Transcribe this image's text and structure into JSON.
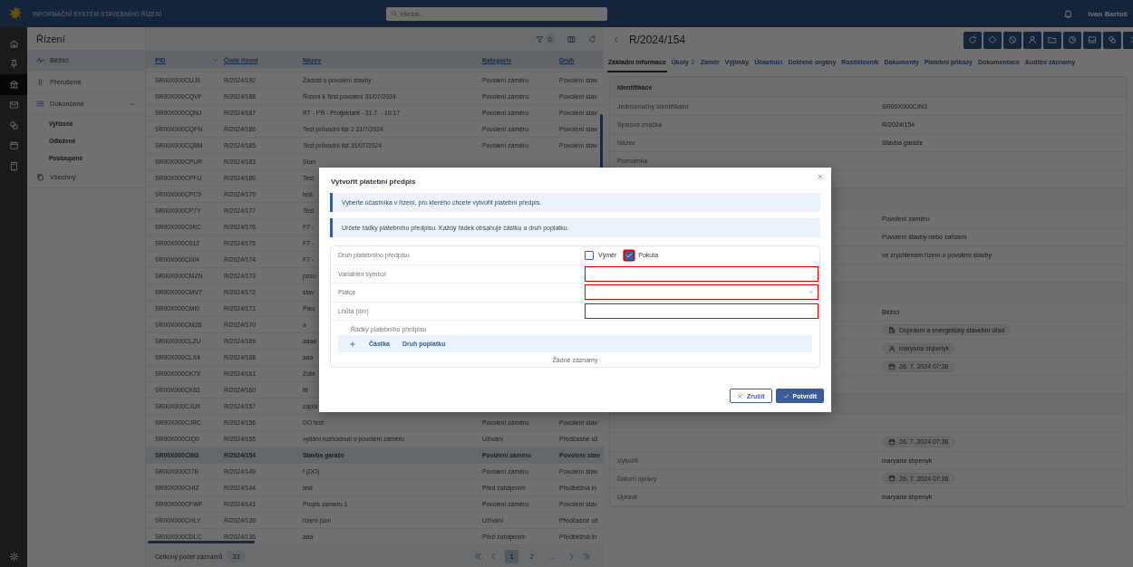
{
  "topbar": {
    "title": "INFORMAČNÍ SYSTÉM STAVEBNÍHO ŘÍZENÍ",
    "search": {
      "placeholder": "Hledat..."
    },
    "user": "Ivan Bartoš"
  },
  "rail": [
    {
      "selected": false
    },
    {
      "selected": false
    },
    {
      "selected": true
    },
    {
      "selected": false
    },
    {
      "selected": false
    },
    {
      "selected": false
    },
    {
      "selected": false
    }
  ],
  "sidebar": {
    "title": "Řízení",
    "items": [
      {
        "label": "Běžící",
        "selected": true
      },
      {
        "label": "Přerušené",
        "selected": false
      },
      {
        "label": "Dokončené",
        "selected": false,
        "expanded": true,
        "children": [
          {
            "label": "Vyřízené",
            "selected": false
          },
          {
            "label": "Odložené",
            "selected": false
          },
          {
            "label": "Postoupené",
            "selected": false
          }
        ]
      },
      {
        "label": "Všechny",
        "selected": false
      }
    ]
  },
  "table": {
    "filter_badge": "0",
    "columns": [
      "PID",
      "Číslo řízení",
      "Název",
      "Kategorie",
      "Druh"
    ],
    "rows": [
      {
        "pid": "SR00X000CUJ3",
        "number": "R/2024/192",
        "name": "Žádost o povolení stavby",
        "category": "Povolení záměru",
        "kind": "Povolení stav",
        "selected": false
      },
      {
        "pid": "SR00X000CQVF",
        "number": "R/2024/188",
        "name": "Řízení k Test povolení 31/07/2024",
        "category": "Povolení záměru",
        "kind": "Povolení stav",
        "selected": false
      },
      {
        "pid": "SR00X000CQNJ",
        "number": "R/2024/187",
        "name": "RT - PR - Protjektant - 31.7. - 10:17",
        "category": "Povolení záměru",
        "kind": "Povolení stav",
        "selected": false
      },
      {
        "pid": "SR00X000CQFN",
        "number": "R/2024/186",
        "name": "Test průvodní list 2 31/7/2024",
        "category": "Povolení záměru",
        "kind": "Povolení stav",
        "selected": false
      },
      {
        "pid": "SR00X000CQ8M",
        "number": "R/2024/185",
        "name": "Test průvodní list 31/07/2024",
        "category": "Povolení záměru",
        "kind": "Povolení stav",
        "selected": false
      },
      {
        "pid": "SR00X000CPUR",
        "number": "R/2024/183",
        "name": "Stan",
        "selected": false
      },
      {
        "pid": "SR00X000CPFU",
        "number": "R/2024/180",
        "name": "Test",
        "selected": false
      },
      {
        "pid": "SR00X000CPC9",
        "number": "R/2024/179",
        "name": "test",
        "selected": false
      },
      {
        "pid": "SR00X000CP7Y",
        "number": "R/2024/177",
        "name": "Test",
        "selected": false
      },
      {
        "pid": "SR00X000C0KC",
        "number": "R/2024/176",
        "name": "F7 -",
        "selected": false
      },
      {
        "pid": "SR00X000C01Z",
        "number": "R/2024/175",
        "name": "F7 -",
        "selected": false
      },
      {
        "pid": "SR00X000C004",
        "number": "R/2024/174",
        "name": "F7 -",
        "selected": false
      },
      {
        "pid": "SR00X000CMZN",
        "number": "R/2024/173",
        "name": "pozo",
        "selected": false
      },
      {
        "pid": "SR00X000CMV7",
        "number": "R/2024/172",
        "name": "stav",
        "selected": false
      },
      {
        "pid": "SR00X000CMI0",
        "number": "R/2024/171",
        "name": "Parc",
        "selected": false
      },
      {
        "pid": "SR00X000CM2B",
        "number": "R/2024/170",
        "name": "a",
        "selected": false
      },
      {
        "pid": "SR00X000CLZU",
        "number": "R/2024/169",
        "name": "aaaa",
        "selected": false
      },
      {
        "pid": "SR00X000CLX4",
        "number": "R/2024/168",
        "name": "aaa",
        "selected": false
      },
      {
        "pid": "SR00X000CK7X",
        "number": "R/2024/161",
        "name": "Zobr",
        "selected": false
      },
      {
        "pid": "SR00X000CK62",
        "number": "R/2024/160",
        "name": "ttt",
        "selected": false
      },
      {
        "pid": "SR00X000CJUX",
        "number": "R/2024/157",
        "name": "zapla",
        "selected": false
      },
      {
        "pid": "SR00X000CJRC",
        "number": "R/2024/156",
        "name": "DO test",
        "category": "Povolení záměru",
        "kind": "Povolení stav",
        "selected": false
      },
      {
        "pid": "SR00X000CIQ0",
        "number": "R/2024/155",
        "name": "vydání rozhodnutí o povolení záměru",
        "category": "Užívání",
        "kind": "Předčasné už",
        "selected": false
      },
      {
        "pid": "SR00X000CIN3",
        "number": "R/2024/154",
        "name": "Stavba garáže",
        "category": "Povolení záměru",
        "kind": "Povolení stav",
        "selected": true
      },
      {
        "pid": "SR00X000CI7B",
        "number": "R/2024/149",
        "name": "f (DO)",
        "category": "Povolení záměru",
        "kind": "Povolení stav",
        "selected": false
      },
      {
        "pid": "SR00X000CHIZ",
        "number": "R/2024/144",
        "name": "test",
        "category": "Před zahájením",
        "kind": "Předběžná in",
        "selected": false
      },
      {
        "pid": "SR00X000CFWF",
        "number": "R/2024/141",
        "name": "Propis zameru 1",
        "category": "Povolení záměru",
        "kind": "Povolení stav",
        "selected": false
      },
      {
        "pid": "SR00X000CHLY",
        "number": "R/2024/139",
        "name": "řízení json",
        "category": "Užívání",
        "kind": "Předčasné už",
        "selected": false
      },
      {
        "pid": "SR00X000CDLC",
        "number": "R/2024/136",
        "name": "aaa",
        "category": "Před zahájením",
        "kind": "Předběžná in",
        "selected": false
      }
    ],
    "total_label": "Celkový počet záznamů",
    "total": "33",
    "pages": [
      {
        "label": "1",
        "selected": true
      },
      {
        "label": "2",
        "selected": false
      }
    ],
    "ellipsis": "..."
  },
  "detail": {
    "title": "R/2024/154",
    "tabs": [
      {
        "label": "Základní informace",
        "selected": true
      },
      {
        "label": "Úkoly",
        "selected": false,
        "badge": "0"
      },
      {
        "label": "Záměr",
        "selected": false
      },
      {
        "label": "Výjimky",
        "selected": false
      },
      {
        "label": "Účastníci",
        "selected": false
      },
      {
        "label": "Dotčené orgány",
        "selected": false
      },
      {
        "label": "Rozdělovník",
        "selected": false
      },
      {
        "label": "Dokumenty",
        "selected": false
      },
      {
        "label": "Platební příkazy",
        "selected": false
      },
      {
        "label": "Dokumentace",
        "selected": false
      },
      {
        "label": "Auditní záznamy",
        "selected": false
      }
    ],
    "rows": [
      {
        "kind": "section",
        "label": "Identifikace"
      },
      {
        "kind": "text",
        "label": "Jednoznačný identifikátor",
        "value": "SR00X000CIN3"
      },
      {
        "kind": "text",
        "label": "Spisová značka",
        "value": "R/2024/154"
      },
      {
        "kind": "text",
        "label": "Název",
        "value": "Stavba garáže"
      },
      {
        "kind": "text",
        "label": "Poznámka"
      },
      {
        "kind": "text"
      },
      {
        "kind": "section"
      },
      {
        "kind": "text",
        "value": "Povolení záměru"
      },
      {
        "kind": "text",
        "value": "Povolení stavby nebo zařízení"
      },
      {
        "kind": "text",
        "value": "ve zrychleném řízení o povolení stavby"
      },
      {
        "kind": "text"
      },
      {
        "kind": "section"
      },
      {
        "kind": "text",
        "value": "Běžící"
      },
      {
        "kind": "office",
        "value": "Dopravní a energetický stavební úřad"
      },
      {
        "kind": "person",
        "value": "maryana shpenyk"
      },
      {
        "kind": "date",
        "value": "26. 7. 2024 07:36"
      },
      {
        "kind": "text"
      },
      {
        "kind": "section"
      },
      {
        "kind": "text"
      },
      {
        "kind": "date",
        "value": "26. 7. 2024 07:36"
      },
      {
        "kind": "text",
        "label": "Vytvořil",
        "value": "maryana shpenyk"
      },
      {
        "kind": "date",
        "label": "Datum úpravy",
        "value": "26. 7. 2024 07:36"
      },
      {
        "kind": "text",
        "label": "Upravil",
        "value": "maryana shpenyk"
      }
    ]
  },
  "modal": {
    "title": "Vytvořit platební předpis",
    "notes": [
      "Vyberte účastníka v řízení, pro kterého chcete vytvořit platební předpis.",
      "Určete řádky platebního předpisu. Každý řádek obsahuje částku a druh poplatku."
    ],
    "payment_type": {
      "label": "Druh platebního předpisu",
      "options": [
        {
          "label": "Výměr",
          "checked": false,
          "invalid": false
        },
        {
          "label": "Pokuta",
          "checked": true,
          "invalid": true
        }
      ]
    },
    "fields": [
      {
        "label": "Variabilní symbol",
        "kind": "input",
        "invalid": true
      },
      {
        "label": "Plátce",
        "kind": "select",
        "invalid": true
      },
      {
        "label": "Lhůta (dní)",
        "kind": "input",
        "invalid": true
      }
    ],
    "lines": {
      "title": "Řádky platebního předpisu",
      "columns": [
        "Částka",
        "Druh poplatku"
      ],
      "empty": "Žádné záznamy"
    },
    "buttons": [
      {
        "label": "Zrušit",
        "kind": "cancel"
      },
      {
        "label": "Potvrdit",
        "kind": "confirm"
      }
    ]
  }
}
